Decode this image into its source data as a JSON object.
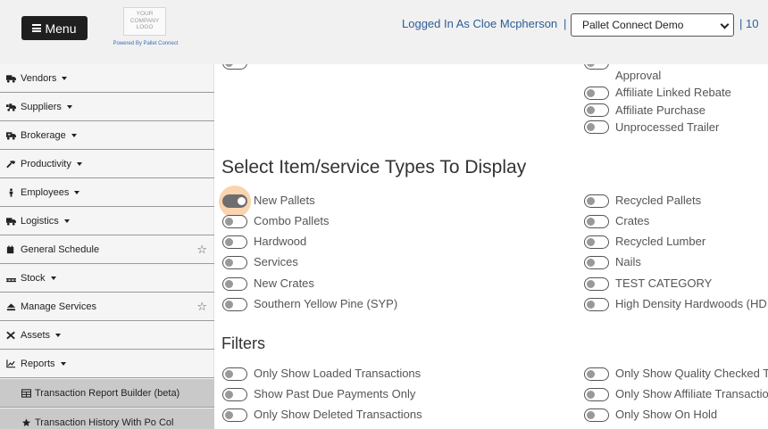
{
  "header": {
    "menu_label": "Menu",
    "logo_lines": [
      "YOUR",
      "COMPANY",
      "LOGO"
    ],
    "powered_by": "Powered By Pallet Connect",
    "logged_in": "Logged In As Cloe Mcpherson",
    "separator": "|",
    "company_select": "Pallet Connect Demo",
    "trailing": "| 10"
  },
  "sidebar": {
    "items": [
      {
        "label": "Vendors",
        "icon": "truck-icon"
      },
      {
        "label": "Suppliers",
        "icon": "truck-loading-icon"
      },
      {
        "label": "Brokerage",
        "icon": "handshake-truck-icon"
      },
      {
        "label": "Productivity",
        "icon": "hammer-icon"
      },
      {
        "label": "Employees",
        "icon": "person-icon"
      },
      {
        "label": "Logistics",
        "icon": "truck-icon"
      },
      {
        "label": "General Schedule",
        "icon": "calendar-icon"
      },
      {
        "label": "Stock",
        "icon": "pallet-icon"
      },
      {
        "label": "Manage Services",
        "icon": "eject-icon"
      },
      {
        "label": "Assets",
        "icon": "tools-icon"
      },
      {
        "label": "Reports",
        "icon": "chart-line-icon"
      }
    ],
    "subitems": [
      {
        "label": "Transaction Report Builder (beta)",
        "icon": "table-icon"
      },
      {
        "label": "Transaction History With Po Col",
        "icon": "star-icon"
      }
    ]
  },
  "main": {
    "top_section": {
      "right_options": [
        "Approval",
        "Affiliate Linked Rebate",
        "Affiliate Purchase",
        "Unprocessed Trailer"
      ]
    },
    "item_types": {
      "title": "Select Item/service Types To Display",
      "left": [
        "New Pallets",
        "Combo Pallets",
        "Hardwood",
        "Services",
        "New Crates",
        "Southern Yellow Pine (SYP)"
      ],
      "right": [
        "Recycled Pallets",
        "Crates",
        "Recycled Lumber",
        "Nails",
        "TEST CATEGORY",
        "High Density Hardwoods (HD"
      ],
      "checked": [
        "New Pallets"
      ]
    },
    "filters": {
      "title": "Filters",
      "left": [
        "Only Show Loaded Transactions",
        "Show Past Due Payments Only",
        "Only Show Deleted Transactions"
      ],
      "right": [
        "Only Show Quality Checked T",
        "Only Show Affiliate Transactio",
        "Only Show On Hold"
      ]
    }
  },
  "colors": {
    "header_bg": "#f1f1f1",
    "menu_btn": "#1f1f1f",
    "link_blue": "#2c5d99",
    "sidebar_bg": "#f5f5f5",
    "submenu_bg": "#c9c9c9",
    "toggle_on": "#6e6e6e",
    "focus_halo": "#f6b06c"
  }
}
